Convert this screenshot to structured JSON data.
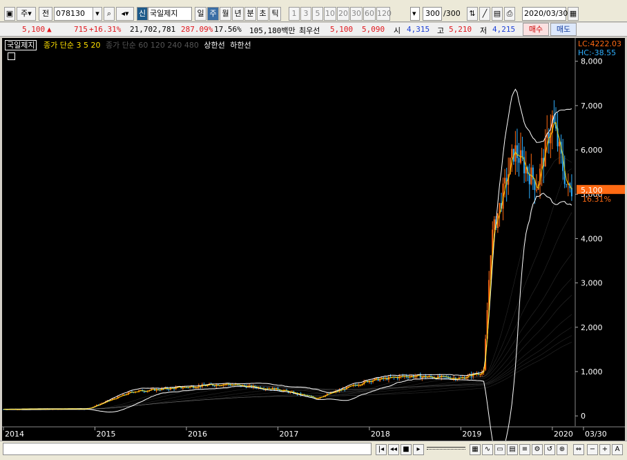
{
  "toolbar": {
    "type_select": "주",
    "prev_label": "전",
    "code": "078130",
    "name_tag": "신",
    "stock_name": "국일제지",
    "periods": [
      "일",
      "주",
      "월",
      "년",
      "분",
      "초",
      "틱"
    ],
    "selected_period": "주",
    "intervals": [
      "1",
      "3",
      "5",
      "10",
      "20",
      "30",
      "60",
      "120"
    ],
    "count": "300",
    "count_total": "/300",
    "date": "2020/03/30"
  },
  "quote": {
    "price": "5,100",
    "arrow": "▲",
    "change": "715",
    "change_pct": "+16.31%",
    "volume": "21,702,781",
    "vol_ratio": "287.09%",
    "turnover": "17.56%",
    "amount": "105,180백만",
    "best_label": "최우선",
    "best_ask": "5,100",
    "best_bid": "5,090",
    "open_label": "시",
    "open": "4,315",
    "high_label": "고",
    "high": "5,210",
    "low_label": "저",
    "low": "4,215",
    "buy_label": "매수",
    "sell_label": "매도"
  },
  "legend": {
    "name": "국일제지",
    "ma_short": "종가 단순 3  5  20",
    "ma_long": "종가 단순 60  120  240  480",
    "upper": "상한선",
    "lower": "하한선"
  },
  "chart_data": {
    "type": "candlestick",
    "yticks": [
      "8,000",
      "7,000",
      "6,000",
      "5,000",
      "4,000",
      "3,000",
      "2,000",
      "1,000",
      "0"
    ],
    "ylim": [
      -200,
      8400
    ],
    "xticks": [
      "2014",
      "2015",
      "2016",
      "2017",
      "2018",
      "2019",
      "2020",
      "03/30"
    ],
    "last_price_label": "5,100",
    "last_pct_label": "16.31%",
    "lc_label": "LC:4222.03",
    "hc_label": "HC:-38.55",
    "colors": {
      "up": "#ff6a13",
      "down": "#2fb0ff",
      "band": "#ffffff",
      "price_box": "#ff6a13"
    },
    "weekly_close_samples": [
      {
        "date": "2014-01",
        "value": 150
      },
      {
        "date": "2014-12",
        "value": 160
      },
      {
        "date": "2015-06",
        "value": 550
      },
      {
        "date": "2016-01",
        "value": 650
      },
      {
        "date": "2016-06",
        "value": 720
      },
      {
        "date": "2017-01",
        "value": 600
      },
      {
        "date": "2017-06",
        "value": 400
      },
      {
        "date": "2018-01",
        "value": 800
      },
      {
        "date": "2018-06",
        "value": 900
      },
      {
        "date": "2019-01",
        "value": 850
      },
      {
        "date": "2019-04",
        "value": 1000
      },
      {
        "date": "2019-05",
        "value": 4000
      },
      {
        "date": "2019-08",
        "value": 6000
      },
      {
        "date": "2019-11",
        "value": 5200
      },
      {
        "date": "2020-01",
        "value": 6700
      },
      {
        "date": "2020-03",
        "value": 5100
      }
    ]
  },
  "bottom": {
    "zoom_out": "−",
    "zoom_in": "+",
    "font_btn": "A"
  }
}
